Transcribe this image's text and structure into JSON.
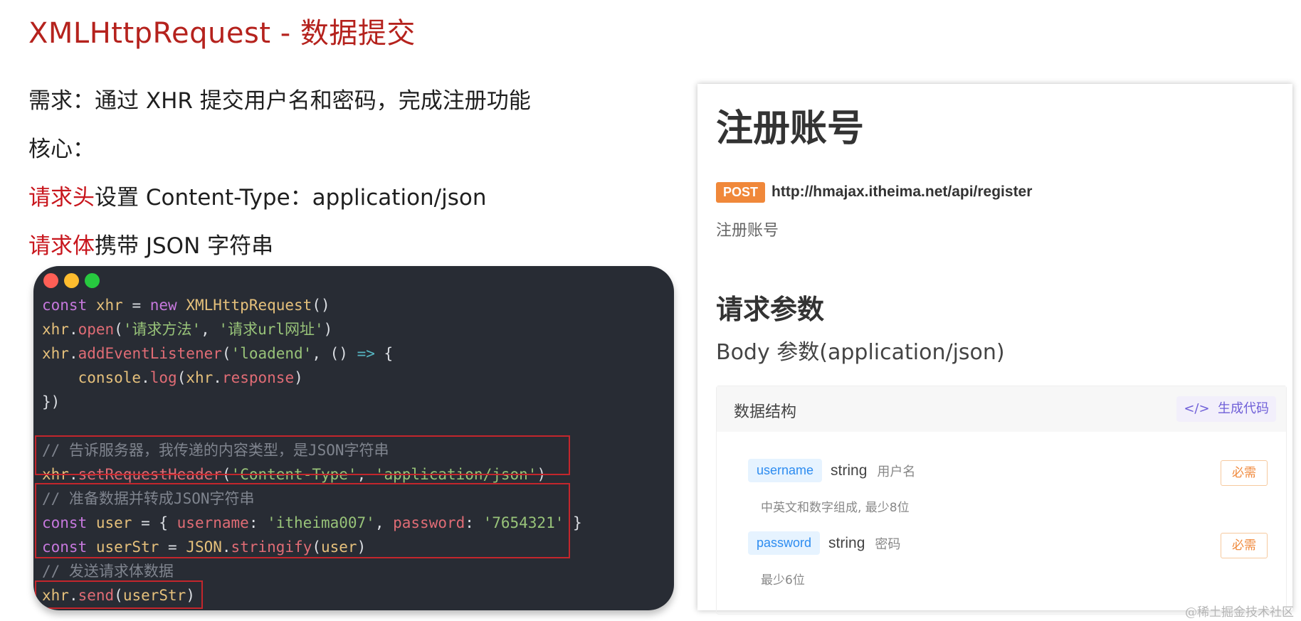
{
  "slide": {
    "title": "XMLHttpRequest - 数据提交",
    "requirement": "需求：通过 XHR 提交用户名和密码，完成注册功能",
    "core_label": "核心：",
    "header_hl": "请求头",
    "header_rest": "设置 Content-Type：application/json",
    "body_hl": "请求体",
    "body_rest": "携带 JSON 字符串"
  },
  "code_window": {
    "dot_colors": [
      "#ff5f56",
      "#ffbd2e",
      "#27c93f"
    ],
    "lines": [
      [
        [
          "kw",
          "const "
        ],
        [
          "var",
          "xhr"
        ],
        [
          "p",
          " = "
        ],
        [
          "kw",
          "new "
        ],
        [
          "cls",
          "XMLHttpRequest"
        ],
        [
          "p",
          "()"
        ]
      ],
      [
        [
          "var",
          "xhr"
        ],
        [
          "p",
          "."
        ],
        [
          "fn",
          "open"
        ],
        [
          "p",
          "("
        ],
        [
          "str",
          "'请求方法'"
        ],
        [
          "p",
          ", "
        ],
        [
          "str",
          "'请求url网址'"
        ],
        [
          "p",
          ")"
        ]
      ],
      [
        [
          "var",
          "xhr"
        ],
        [
          "p",
          "."
        ],
        [
          "fn",
          "addEventListener"
        ],
        [
          "p",
          "("
        ],
        [
          "str",
          "'loadend'"
        ],
        [
          "p",
          ", () "
        ],
        [
          "op",
          "=>"
        ],
        [
          "p",
          " {"
        ]
      ],
      [
        [
          "p",
          "    "
        ],
        [
          "var",
          "console"
        ],
        [
          "p",
          "."
        ],
        [
          "fn",
          "log"
        ],
        [
          "p",
          "("
        ],
        [
          "var",
          "xhr"
        ],
        [
          "p",
          "."
        ],
        [
          "prop",
          "response"
        ],
        [
          "p",
          ")"
        ]
      ],
      [
        [
          "p",
          "})"
        ]
      ],
      [
        [
          "p",
          ""
        ]
      ],
      [
        [
          "cm",
          "// 告诉服务器，我传递的内容类型，是JSON字符串"
        ]
      ],
      [
        [
          "var",
          "xhr"
        ],
        [
          "p",
          "."
        ],
        [
          "fn",
          "setRequestHeader"
        ],
        [
          "p",
          "("
        ],
        [
          "str",
          "'Content-Type'"
        ],
        [
          "p",
          ", "
        ],
        [
          "str",
          "'application/json'"
        ],
        [
          "p",
          ")"
        ]
      ],
      [
        [
          "cm",
          "// 准备数据并转成JSON字符串"
        ]
      ],
      [
        [
          "kw",
          "const "
        ],
        [
          "var",
          "user"
        ],
        [
          "p",
          " = { "
        ],
        [
          "prop",
          "username"
        ],
        [
          "p",
          ": "
        ],
        [
          "str",
          "'itheima007'"
        ],
        [
          "p",
          ", "
        ],
        [
          "prop",
          "password"
        ],
        [
          "p",
          ": "
        ],
        [
          "str",
          "'7654321'"
        ],
        [
          "p",
          " }"
        ]
      ],
      [
        [
          "kw",
          "const "
        ],
        [
          "var",
          "userStr"
        ],
        [
          "p",
          " = "
        ],
        [
          "cls",
          "JSON"
        ],
        [
          "p",
          "."
        ],
        [
          "fn",
          "stringify"
        ],
        [
          "p",
          "("
        ],
        [
          "var",
          "user"
        ],
        [
          "p",
          ")"
        ]
      ],
      [
        [
          "cm",
          "// 发送请求体数据"
        ]
      ],
      [
        [
          "var",
          "xhr"
        ],
        [
          "p",
          "."
        ],
        [
          "fn",
          "send"
        ],
        [
          "p",
          "("
        ],
        [
          "var",
          "userStr"
        ],
        [
          "p",
          ")"
        ]
      ]
    ]
  },
  "doc": {
    "title": "注册账号",
    "method": "POST",
    "url": "http://hmajax.itheima.net/api/register",
    "description": "注册账号",
    "section_title": "请求参数",
    "body_label": "Body 参数(application/json)",
    "struct_label": "数据结构",
    "gen_code_label": "生成代码",
    "params": [
      {
        "name": "username",
        "type": "string",
        "note": "用户名",
        "desc": "中英文和数字组成, 最少8位",
        "required": "必需"
      },
      {
        "name": "password",
        "type": "string",
        "note": "密码",
        "desc": "最少6位",
        "required": "必需"
      }
    ]
  },
  "watermark": "@稀土掘金技术社区"
}
